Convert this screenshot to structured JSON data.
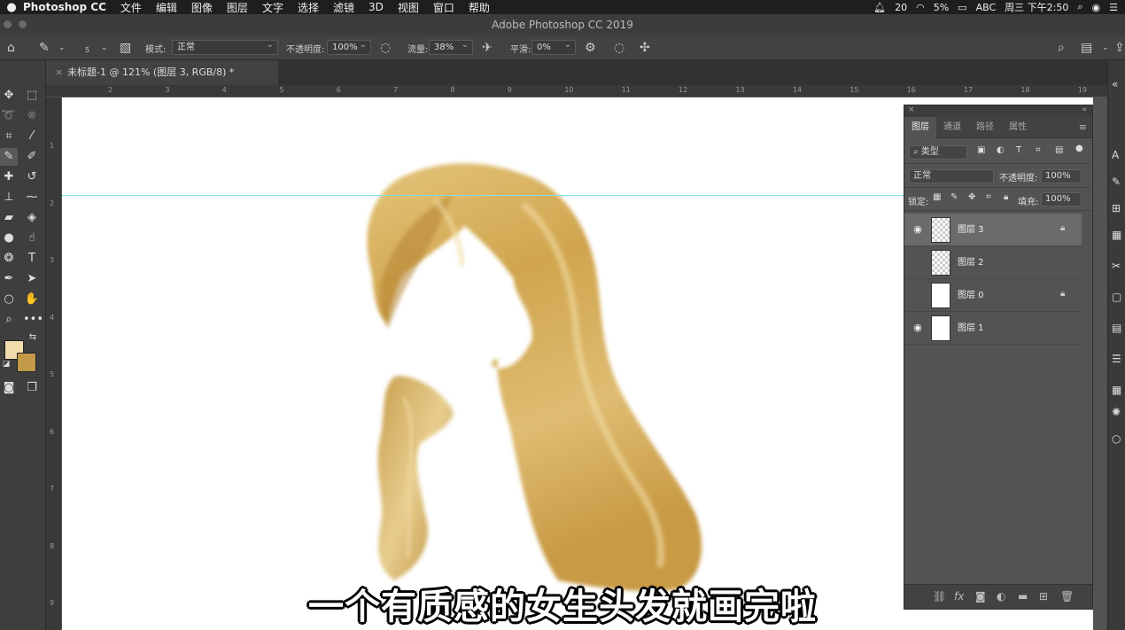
{
  "menubar": {
    "app_name": "Photoshop CC",
    "items": [
      "文件",
      "编辑",
      "图像",
      "图层",
      "文字",
      "选择",
      "滤镜",
      "3D",
      "视图",
      "窗口",
      "帮助"
    ],
    "status": {
      "notifications": "20",
      "battery": "5%",
      "input": "ABC",
      "datetime": "周三 下午2:50"
    }
  },
  "window_title": "Adobe Photoshop CC 2019",
  "options_bar": {
    "brush_size": "5",
    "mode_label": "模式:",
    "mode_value": "正常",
    "opacity_label": "不透明度:",
    "opacity_value": "100%",
    "flow_label": "流量:",
    "flow_value": "38%",
    "smoothing_label": "平滑:",
    "smoothing_value": "0%"
  },
  "document_tab": {
    "title": "未标题-1 @ 121% (图层 3, RGB/8) *"
  },
  "ruler": {
    "top_ticks": [
      "2",
      "3",
      "4",
      "5",
      "6",
      "7",
      "8",
      "9",
      "10",
      "11",
      "12",
      "13",
      "14",
      "15",
      "16",
      "17",
      "18",
      "19"
    ],
    "left_ticks": [
      "1",
      "2",
      "3",
      "4",
      "5",
      "6",
      "7",
      "8",
      "9"
    ]
  },
  "colors": {
    "foreground": "#f2dcae",
    "background": "#c29a4a",
    "guide": "#7fe0e8"
  },
  "layers_panel": {
    "tabs": [
      "图层",
      "通道",
      "路径",
      "属性"
    ],
    "filter_label": "类型",
    "blend_mode": "正常",
    "opacity_label": "不透明度:",
    "opacity_value": "100%",
    "lock_label": "锁定:",
    "fill_label": "填充:",
    "fill_value": "100%",
    "layers": [
      {
        "name": "图层 3",
        "visible": true,
        "locked": true,
        "selected": true
      },
      {
        "name": "图层 2",
        "visible": false,
        "locked": false,
        "selected": false
      },
      {
        "name": "图层 0",
        "visible": false,
        "locked": true,
        "selected": false
      },
      {
        "name": "图层 1",
        "visible": true,
        "locked": false,
        "selected": false
      }
    ]
  },
  "subtitle": "一个有质感的女生头发就画完啦"
}
